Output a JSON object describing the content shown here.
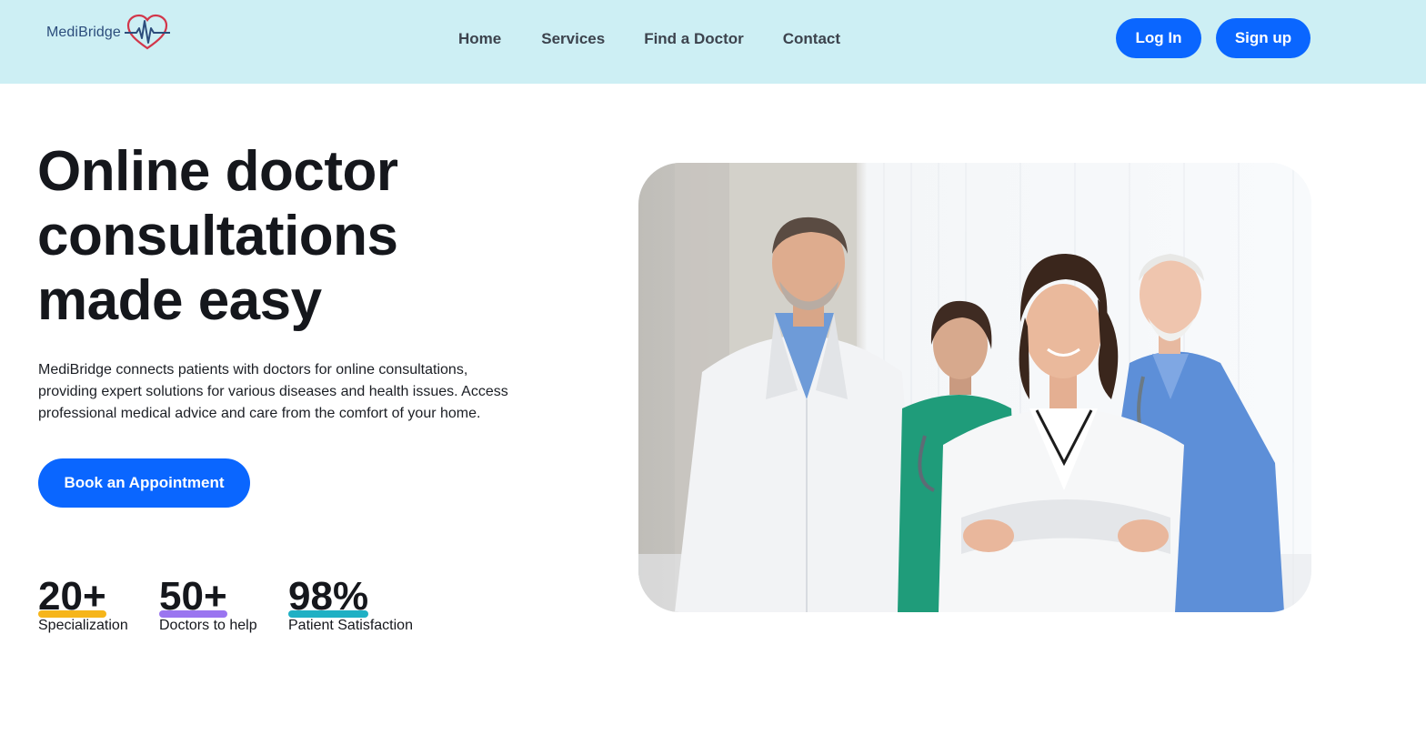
{
  "header": {
    "logo_text": "MediBridge",
    "nav": [
      "Home",
      "Services",
      "Find a Doctor",
      "Contact"
    ],
    "login_label": "Log In",
    "signup_label": "Sign up"
  },
  "hero": {
    "title_lines": [
      "Online doctor",
      "consultations",
      "made easy"
    ],
    "description_lines": [
      "MediBridge connects patients with doctors for online consultations,",
      "providing expert solutions for various diseases and health issues. Access",
      "professional medical advice and care from the comfort of your home."
    ],
    "cta_label": "Book an Appointment"
  },
  "stats": [
    {
      "value": "20+",
      "label": "Specialization",
      "accent": "#f6b51a"
    },
    {
      "value": "50+",
      "label": "Doctors to help",
      "accent": "#9a75f0"
    },
    {
      "value": "98%",
      "label": "Patient Satisfaction",
      "accent": "#1fb0c4"
    }
  ],
  "colors": {
    "header_bg": "#cdeff4",
    "primary": "#0a66ff",
    "logo_heart": "#d2364a",
    "logo_text": "#2c4d7c"
  },
  "image": {
    "icon": "medical-team-photo"
  }
}
